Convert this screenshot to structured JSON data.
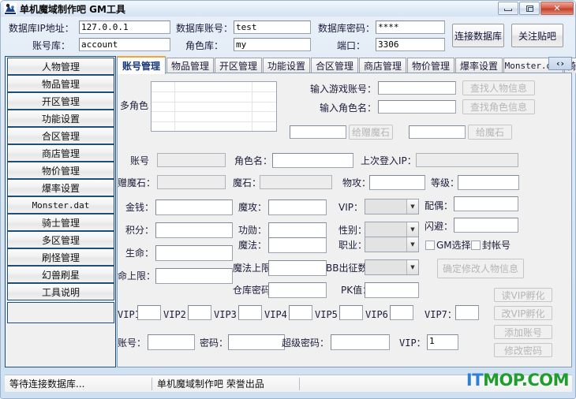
{
  "window": {
    "title": "单机魔域制作吧 GM工具",
    "icon": "app-icon",
    "buttons": {
      "minimize": "–",
      "restore": "❐",
      "close": "✕"
    }
  },
  "topform": {
    "fields": [
      {
        "label": "数据库IP地址：",
        "value": "127.0.0.1"
      },
      {
        "label": "数据库账号：",
        "value": "test"
      },
      {
        "label": "数据库密码：",
        "value": "****"
      },
      {
        "label": "账号库：",
        "value": "account"
      },
      {
        "label": "角色库：",
        "value": "my"
      },
      {
        "label": "端口：",
        "value": "3306"
      }
    ],
    "connect_button": "连接数据库",
    "follow_button": "关注贴吧"
  },
  "sidebar": {
    "items": [
      {
        "label": "人物管理"
      },
      {
        "label": "物品管理"
      },
      {
        "label": "开区管理"
      },
      {
        "label": "功能设置"
      },
      {
        "label": "合区管理"
      },
      {
        "label": "商店管理"
      },
      {
        "label": "物价管理"
      },
      {
        "label": "爆率设置"
      },
      {
        "label": "Monster.dat",
        "mono": true
      },
      {
        "label": "骑士管理"
      },
      {
        "label": "多区管理"
      },
      {
        "label": "刷怪管理"
      },
      {
        "label": "幻兽刷星"
      },
      {
        "label": "工具说明"
      }
    ]
  },
  "tabs": {
    "items": [
      {
        "label": "账号管理",
        "active": true
      },
      {
        "label": "物品管理"
      },
      {
        "label": "开区管理"
      },
      {
        "label": "功能设置"
      },
      {
        "label": "合区管理"
      },
      {
        "label": "商店管理"
      },
      {
        "label": "物价管理"
      },
      {
        "label": "爆率设置"
      },
      {
        "label": "Monster.dat",
        "mono": true
      },
      {
        "label": "骑士"
      }
    ],
    "scroll_left": "‹",
    "scroll_right": "›"
  },
  "page": {
    "multirole_label": "多角色",
    "search": {
      "account_label": "输入游戏账号：",
      "account_value": "",
      "account_button": "查找人物信息",
      "role_label": "输入角色名：",
      "role_value": "",
      "role_button": "查找角色信息"
    },
    "gift": {
      "give_gift_value": "",
      "give_gift_button": "给赠魔石",
      "give_stone_value": "",
      "give_stone_button": "给魔石"
    },
    "row1": {
      "account_label": "账号",
      "account_value": "",
      "rolename_label": "角色名：",
      "rolename_value": "",
      "lastip_label": "上次登入IP：",
      "lastip_value": ""
    },
    "row2": {
      "giftstone_label": "赠魔石：",
      "giftstone_value": "",
      "stone_label": "魔石：",
      "stone_value": "",
      "patk_label": "物攻：",
      "patk_value": "",
      "level_label": "等级：",
      "level_value": ""
    },
    "row3": {
      "money_label": "金钱：",
      "money_value": "",
      "matk_label": "魔攻：",
      "matk_value": "",
      "vip_label": "VIP：",
      "vip_value": "",
      "spouse_label": "配偶：",
      "spouse_value": ""
    },
    "row4": {
      "points_label": "积分：",
      "points_value": "",
      "merit_label": "功勋：",
      "merit_value": "",
      "gender_label": "性别：",
      "gender_value": "",
      "dodge_label": "闪避：",
      "dodge_value": ""
    },
    "row5": {
      "hp_label": "生命：",
      "hp_value": "",
      "mp_label": "魔法：",
      "mp_value": "",
      "job_label": "职业：",
      "job_value": ""
    },
    "row6": {
      "hpmax_label": "命上限：",
      "hpmax_value": "",
      "mpmax_label": "魔法上限",
      "mpmax_value": "",
      "bb_label": "BB出征数",
      "bb_value": ""
    },
    "row7": {
      "storepw_label": "仓库密码",
      "storepw_value": "",
      "pk_label": "PK值：",
      "pk_value": ""
    },
    "checkboxes": [
      {
        "label": "GM选择",
        "checked": false
      },
      {
        "label": "封帐号",
        "checked": false
      }
    ],
    "confirm_button": "确定修改人物信息",
    "vip_row": [
      {
        "label": "VIP1",
        "value": ""
      },
      {
        "label": "VIP2：",
        "value": ""
      },
      {
        "label": "VIP3：",
        "value": ""
      },
      {
        "label": "VIP4：",
        "value": ""
      },
      {
        "label": "VIP5：",
        "value": ""
      },
      {
        "label": "VIP6：",
        "value": ""
      },
      {
        "label": "VIP7：",
        "value": ""
      }
    ],
    "bottom": {
      "account_label": "账号：",
      "account_value": "",
      "password_label": "密码：",
      "password_value": "",
      "superpw_label": "超级密码：",
      "superpw_value": "",
      "vip_label": "VIP：",
      "vip_value": "1"
    },
    "right_buttons": [
      {
        "label": "读VIP孵化"
      },
      {
        "label": "改VIP孵化"
      },
      {
        "label": "添加账号"
      },
      {
        "label": "修改密码"
      }
    ]
  },
  "statusbar": {
    "cells": [
      "等待连接数据库...",
      "单机魔域制作吧 荣誉出品",
      ""
    ]
  },
  "watermark": {
    "part1": "IT",
    "part2": "MOP",
    "part3": ".COM"
  }
}
